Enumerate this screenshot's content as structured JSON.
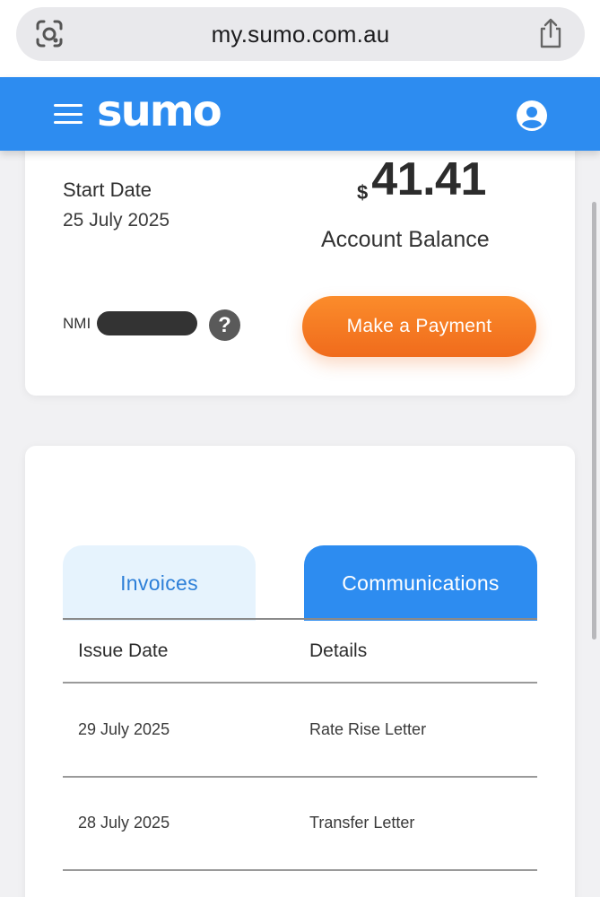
{
  "browser": {
    "url": "my.sumo.com.au"
  },
  "header": {
    "logo": "sumo",
    "accent": "#2d8cf0"
  },
  "account": {
    "start_label": "Start Date",
    "start_value": "25 July 2025",
    "currency": "$",
    "balance": "41.41",
    "balance_label": "Account Balance",
    "nmi_label": "NMI",
    "help_symbol": "?",
    "pay_button": "Make a Payment",
    "pay_color": "#f47a22"
  },
  "tabs": [
    {
      "label": "Invoices",
      "active": false
    },
    {
      "label": "Communications",
      "active": true
    }
  ],
  "table": {
    "headers": [
      "Issue Date",
      "Details"
    ],
    "rows": [
      {
        "date": "29 July 2025",
        "details": "Rate Rise Letter"
      },
      {
        "date": "28 July 2025",
        "details": "Transfer Letter"
      }
    ]
  }
}
